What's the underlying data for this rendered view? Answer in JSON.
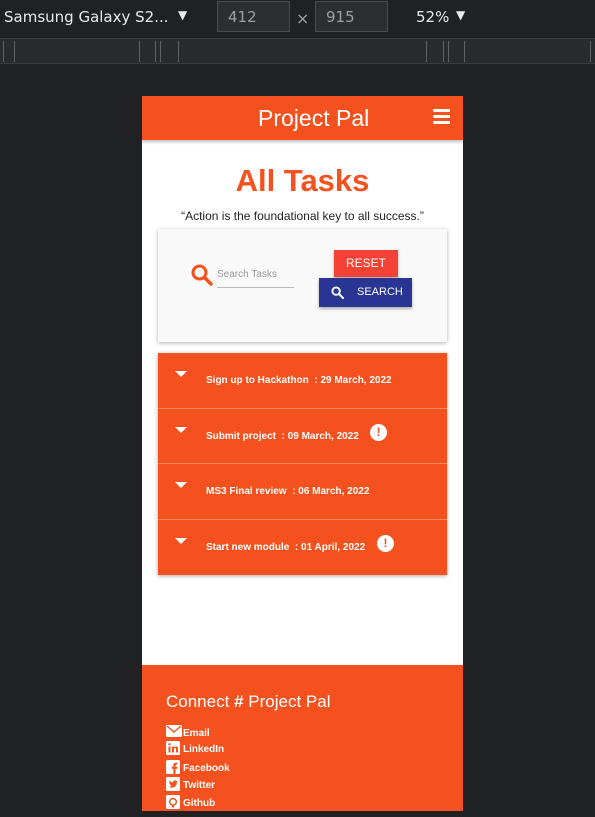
{
  "devtools": {
    "device": "Samsung Galaxy S2...",
    "width": "412",
    "height": "915",
    "zoom": "52%",
    "times_symbol": "×",
    "caret": "▼"
  },
  "navbar": {
    "brand": "Project Pal",
    "menu_icon": "hamburger-icon"
  },
  "page": {
    "title": "All Tasks",
    "quote": "“Action is the foundational key to all success.”"
  },
  "search": {
    "placeholder": "Search Tasks",
    "reset_label": "RESET",
    "search_label": "SEARCH"
  },
  "tasks": [
    {
      "name": "Sign up to Hackathon",
      "date": ": 29 March, 2022",
      "alert": false
    },
    {
      "name": "Submit project",
      "date": ": 09 March, 2022",
      "alert": true
    },
    {
      "name": "MS3 Final review",
      "date": ": 06 March, 2022",
      "alert": false
    },
    {
      "name": "Start new module",
      "date": ": 01 April, 2022",
      "alert": true
    }
  ],
  "footer": {
    "title_pre": "Connect",
    "title_hash": "#",
    "title_post": "Project Pal",
    "links": [
      "Email",
      "LinkedIn",
      "Facebook",
      "Twitter",
      "Github"
    ]
  },
  "colors": {
    "accent": "#f4511e",
    "reset": "#f44336",
    "search": "#283593"
  }
}
